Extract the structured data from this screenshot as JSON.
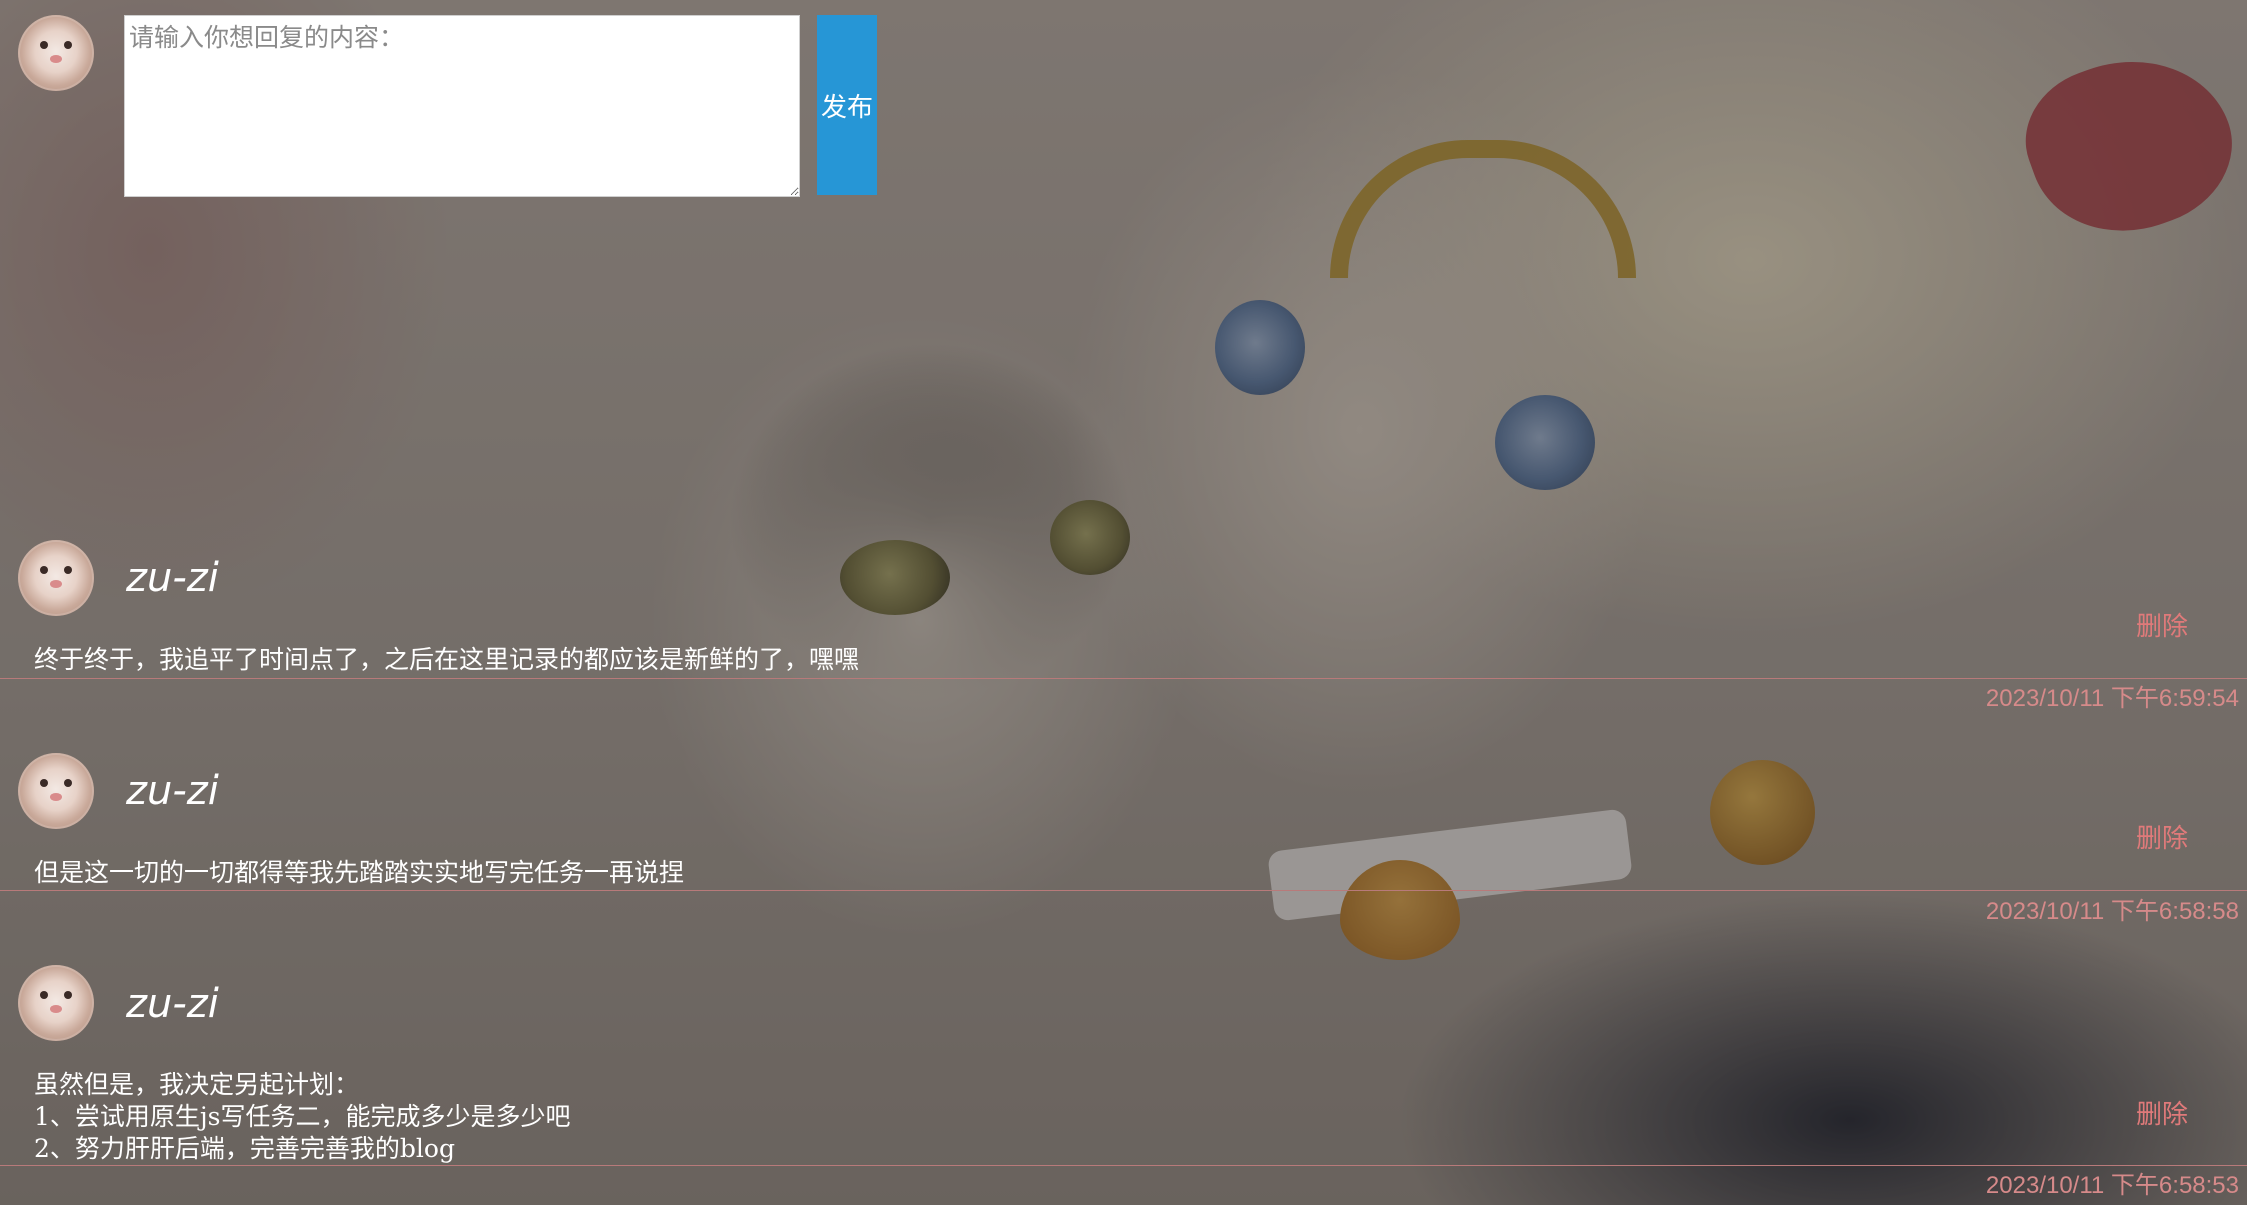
{
  "composer": {
    "placeholder": "请输入你想回复的内容：",
    "value": "",
    "publish_label": "发布"
  },
  "posts": [
    {
      "author": "zu-zi",
      "content": "终于终于，我追平了时间点了，之后在这里记录的都应该是新鲜的了，嘿嘿",
      "delete_label": "删除",
      "timestamp": "2023/10/11 下午6:59:54"
    },
    {
      "author": "zu-zi",
      "content": "但是这一切的一切都得等我先踏踏实实地写完任务一再说捏",
      "delete_label": "删除",
      "timestamp": "2023/10/11 下午6:58:58"
    },
    {
      "author": "zu-zi",
      "content": "虽然但是，我决定另起计划：\n1、尝试用原生js写任务二，能完成多少是多少吧\n2、努力肝肝后端，完善完善我的blog",
      "delete_label": "删除",
      "timestamp": "2023/10/11 下午6:58:53"
    }
  ],
  "colors": {
    "publish_button": "#2696d6",
    "delete_link": "#e07a7a",
    "timestamp": "#d68a8a",
    "divider": "#b87a7a"
  }
}
